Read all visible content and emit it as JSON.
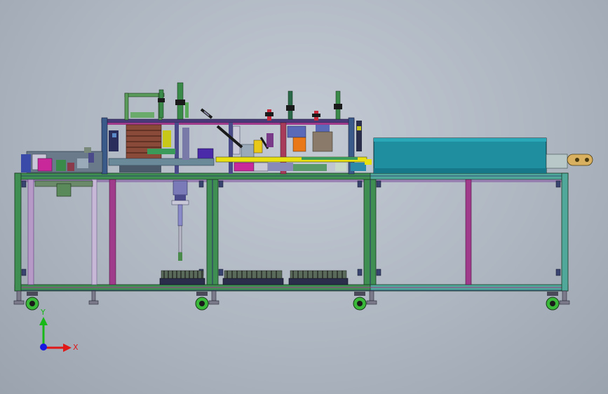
{
  "triad": {
    "x_label": "X",
    "y_label": "Y",
    "x_color": "#e01818",
    "y_color": "#18b818",
    "z_color": "#1818e0"
  },
  "colors": {
    "frame_green": "#3f8f52",
    "frame_teal": "#4fa89a",
    "frame_magenta": "#a03a8a",
    "frame_navy": "#2a2e6a",
    "conveyor_cover": "#1f8fa0",
    "accent_yellow": "#e8e010",
    "accent_red": "#c8283a",
    "accent_orange": "#e87818",
    "caster_green": "#3ab83a"
  }
}
